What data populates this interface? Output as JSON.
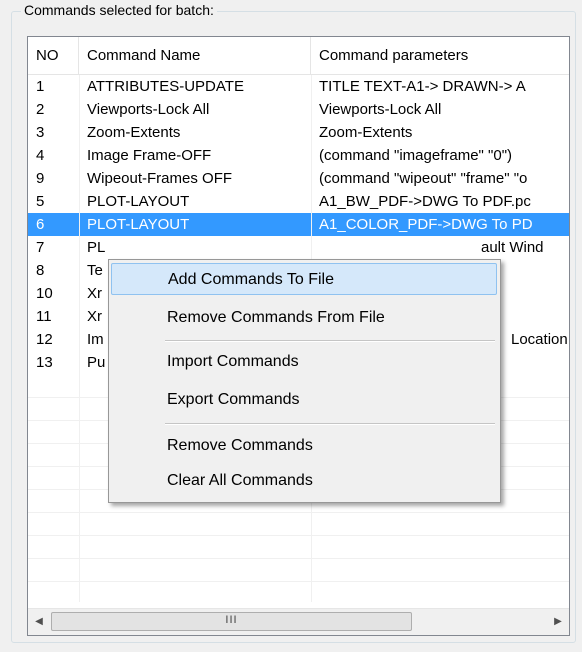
{
  "group": {
    "title": "Commands selected for batch:"
  },
  "list": {
    "columns": [
      "NO",
      "Command Name",
      "Command parameters"
    ],
    "rows": [
      {
        "no": "1",
        "name": "ATTRIBUTES-UPDATE",
        "params": "TITLE TEXT-A1-> DRAWN-> A"
      },
      {
        "no": "2",
        "name": "Viewports-Lock All",
        "params": "Viewports-Lock All"
      },
      {
        "no": "3",
        "name": "Zoom-Extents",
        "params": "Zoom-Extents"
      },
      {
        "no": "4",
        "name": "Image Frame-OFF",
        "params": "(command \"imageframe\" \"0\")"
      },
      {
        "no": "9",
        "name": "Wipeout-Frames OFF",
        "params": "(command \"wipeout\" \"frame\" \"o"
      },
      {
        "no": "5",
        "name": "PLOT-LAYOUT",
        "params": "A1_BW_PDF->DWG To PDF.pc"
      },
      {
        "no": "6",
        "name": "PLOT-LAYOUT",
        "params": "A1_COLOR_PDF->DWG To PD"
      },
      {
        "no": "7",
        "name": "PL",
        "params": "ault Wind"
      },
      {
        "no": "8",
        "name": "Te",
        "params": ""
      },
      {
        "no": "10",
        "name": "Xr",
        "params": ""
      },
      {
        "no": "11",
        "name": "Xr",
        "params": ""
      },
      {
        "no": "12",
        "name": "Im",
        "params": "Location"
      },
      {
        "no": "13",
        "name": "Pu",
        "params": ""
      }
    ],
    "selected_row": "6"
  },
  "scrollbar": {
    "left_arrow": "◀",
    "right_arrow": "▶",
    "thumb_grip": "III"
  },
  "context_menu": {
    "items": [
      "Add Commands To File",
      "Remove Commands From File",
      "Import Commands",
      "Export Commands",
      "Remove Commands",
      "Clear All Commands"
    ],
    "highlighted": "Add Commands To File"
  },
  "colors": {
    "selection": "#3399ff",
    "menu_highlight": "#d5e8fa"
  }
}
